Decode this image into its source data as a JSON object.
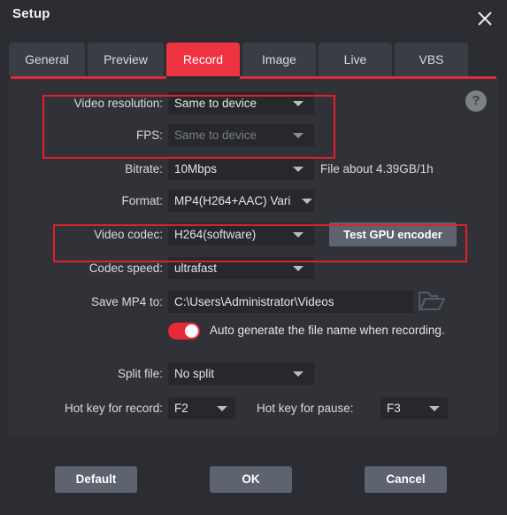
{
  "window": {
    "title": "Setup",
    "close_icon": "close-icon",
    "help_icon": "?"
  },
  "tabs": [
    {
      "label": "General",
      "active": false
    },
    {
      "label": "Preview",
      "active": false
    },
    {
      "label": "Record",
      "active": true
    },
    {
      "label": "Image",
      "active": false
    },
    {
      "label": "Live",
      "active": false
    },
    {
      "label": "VBS",
      "active": false
    }
  ],
  "form": {
    "video_resolution": {
      "label": "Video resolution:",
      "value": "Same to device",
      "disabled": false
    },
    "fps": {
      "label": "FPS:",
      "value": "Same to device",
      "disabled": true
    },
    "bitrate": {
      "label": "Bitrate:",
      "value": "10Mbps",
      "note": "File about 4.39GB/1h"
    },
    "format": {
      "label": "Format:",
      "value": "MP4(H264+AAC) Vari"
    },
    "video_codec": {
      "label": "Video codec:",
      "value": "H264(software)",
      "button": "Test GPU encoder"
    },
    "codec_speed": {
      "label": "Codec speed:",
      "value": "ultrafast"
    },
    "save_path": {
      "label": "Save MP4 to:",
      "value": "C:\\Users\\Administrator\\Videos",
      "browse_icon": "folder-icon"
    },
    "auto_name": {
      "label": "Auto generate the file name when recording.",
      "on": true
    },
    "split_file": {
      "label": "Split file:",
      "value": "No split"
    },
    "hotkey_record": {
      "label": "Hot key for record:",
      "value": "F2"
    },
    "hotkey_pause": {
      "label": "Hot key for pause:",
      "value": "F3"
    }
  },
  "footer": {
    "default_label": "Default",
    "ok_label": "OK",
    "cancel_label": "Cancel"
  },
  "colors": {
    "accent_red": "#ee3442",
    "highlight_red": "#e11f2d",
    "window_bg": "#2b2d33",
    "panel_bg": "#303238",
    "field_bg": "#26282c",
    "button_bg": "#5d6470"
  }
}
